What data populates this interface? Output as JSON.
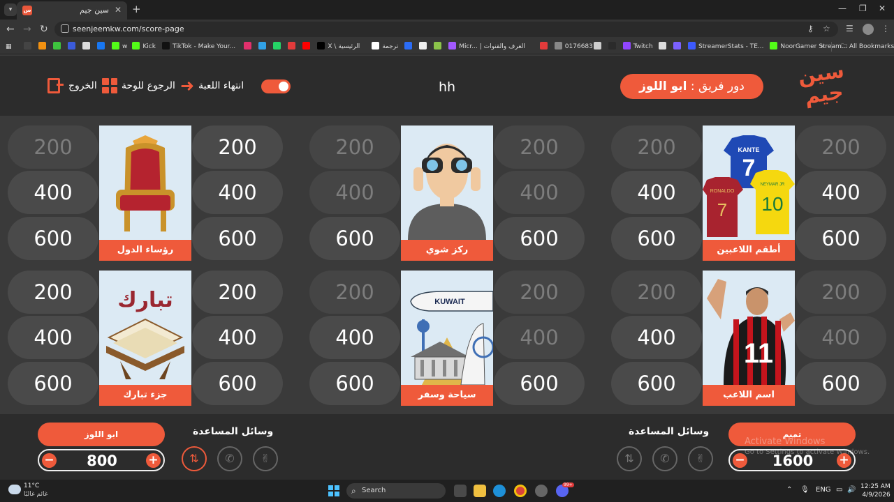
{
  "browser": {
    "tab_title": "سين جيم",
    "tab_favicon": "سين جيم",
    "url": "seenjeemkw.com/score-page",
    "bookmarks": [
      {
        "label": "",
        "color": "#444444"
      },
      {
        "label": "",
        "color": "#f29111"
      },
      {
        "label": "",
        "color": "#3ec43e"
      },
      {
        "label": "",
        "color": "#3b5bdb"
      },
      {
        "label": "",
        "color": "#dddddd"
      },
      {
        "label": "",
        "color": "#1877f2"
      },
      {
        "label": "w",
        "color": "#53fc18"
      },
      {
        "label": "Kick",
        "color": "#53fc18"
      },
      {
        "label": "TikTok - Make Your...",
        "color": "#111111"
      },
      {
        "label": "",
        "color": "#e1306c"
      },
      {
        "label": "",
        "color": "#31a1e6"
      },
      {
        "label": "",
        "color": "#25d366"
      },
      {
        "label": "",
        "color": "#e23b3b"
      },
      {
        "label": "",
        "color": "#ff0000"
      },
      {
        "label": "X \\ الرئيسية",
        "color": "#000000"
      },
      {
        "label": "ترجمة",
        "color": "#ffffff"
      },
      {
        "label": "",
        "color": "#2b6cf6"
      },
      {
        "label": "",
        "color": "#eeeeee"
      },
      {
        "label": "",
        "color": "#8bc34a"
      },
      {
        "label": "Micr... | الغرف والقنوات",
        "color": "#a259ff"
      },
      {
        "label": "",
        "color": "#e23b3b"
      },
      {
        "label": "0176683",
        "color": "#888888"
      },
      {
        "label": "",
        "color": "#cccccc"
      },
      {
        "label": "",
        "color": "#2b2b2b"
      },
      {
        "label": "Twitch",
        "color": "#9146ff"
      },
      {
        "label": "",
        "color": "#dddddd"
      },
      {
        "label": "",
        "color": "#7b61ff"
      },
      {
        "label": "StreamerStats - TE...",
        "color": "#3d5afe"
      },
      {
        "label": "NoorGamer Stream...",
        "color": "#53fc18"
      }
    ],
    "all_bookmarks": "All Bookmarks"
  },
  "header": {
    "exit_label": "الخروج",
    "back_label": "الرجوع للوحة",
    "end_label": "انتهاء اللعبة",
    "game_name": "hh",
    "turn_prefix": "دور فريق :",
    "turn_team": "ابو اللوز",
    "logo_line1": "سين",
    "logo_line2": "جيم"
  },
  "board": {
    "categories": [
      {
        "name": "رؤساء الدول",
        "art": "throne",
        "left": [
          {
            "value": 200,
            "used": true
          },
          {
            "value": 400,
            "used": false
          },
          {
            "value": 600,
            "used": false
          }
        ],
        "right": [
          {
            "value": 200,
            "used": false
          },
          {
            "value": 400,
            "used": false
          },
          {
            "value": 600,
            "used": false
          }
        ]
      },
      {
        "name": "ركز شوي",
        "art": "binoculars",
        "left": [
          {
            "value": 200,
            "used": true
          },
          {
            "value": 400,
            "used": true
          },
          {
            "value": 600,
            "used": false
          }
        ],
        "right": [
          {
            "value": 200,
            "used": true
          },
          {
            "value": 400,
            "used": true
          },
          {
            "value": 600,
            "used": false
          }
        ]
      },
      {
        "name": "أطقم اللاعبين",
        "art": "jerseys",
        "left": [
          {
            "value": 200,
            "used": true
          },
          {
            "value": 400,
            "used": false
          },
          {
            "value": 600,
            "used": false
          }
        ],
        "right": [
          {
            "value": 200,
            "used": true
          },
          {
            "value": 400,
            "used": false
          },
          {
            "value": 600,
            "used": false
          }
        ]
      },
      {
        "name": "جزء تبارك",
        "art": "quran",
        "left": [
          {
            "value": 200,
            "used": false
          },
          {
            "value": 400,
            "used": false
          },
          {
            "value": 600,
            "used": false
          }
        ],
        "right": [
          {
            "value": 200,
            "used": false
          },
          {
            "value": 400,
            "used": false
          },
          {
            "value": 600,
            "used": false
          }
        ]
      },
      {
        "name": "سياحة وسفر",
        "art": "travel",
        "left": [
          {
            "value": 200,
            "used": true
          },
          {
            "value": 400,
            "used": false
          },
          {
            "value": 600,
            "used": false
          }
        ],
        "right": [
          {
            "value": 200,
            "used": true
          },
          {
            "value": 400,
            "used": true
          },
          {
            "value": 600,
            "used": false
          }
        ]
      },
      {
        "name": "اسم اللاعب",
        "art": "player",
        "left": [
          {
            "value": 200,
            "used": true
          },
          {
            "value": 400,
            "used": false
          },
          {
            "value": 600,
            "used": false
          }
        ],
        "right": [
          {
            "value": 200,
            "used": true
          },
          {
            "value": 400,
            "used": true
          },
          {
            "value": 600,
            "used": false
          }
        ]
      }
    ],
    "jersey_texts": [
      "KANTE",
      "7",
      "RONALDO",
      "7",
      "NEYMAR JR",
      "10"
    ],
    "plane_text": "KUWAIT",
    "calligraphy": "تبارك",
    "player_number": "11"
  },
  "teams": {
    "left": {
      "name": "ابو اللوز",
      "score": "800",
      "helpers_title": "وسائل المساعدة",
      "minus": "−",
      "plus": "+"
    },
    "right": {
      "name": "تميم",
      "score": "1600",
      "helpers_title": "وسائل المساعدة",
      "minus": "−",
      "plus": "+"
    }
  },
  "watermark": {
    "line1": "Activate Windows",
    "line2": "Go to Settings to activate Windows."
  },
  "taskbar": {
    "temperature": "11°C",
    "weather_desc": "غائم غالبًا",
    "search": "Search",
    "lang": "ENG",
    "time": "12:25 AM",
    "date": "4/9/2026",
    "badge": "99+"
  }
}
